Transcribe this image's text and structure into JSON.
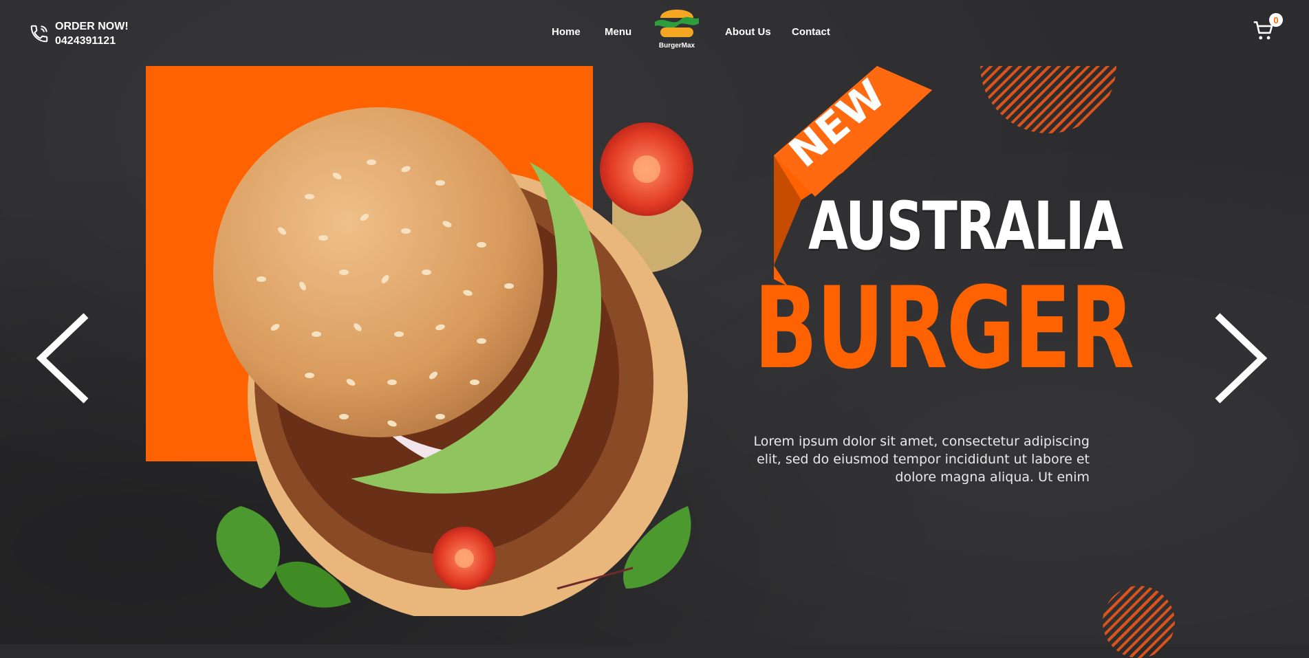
{
  "header": {
    "order_label": "ORDER NOW!",
    "phone": "0424391121",
    "nav": [
      "Home",
      "Menu",
      "About Us",
      "Contact"
    ],
    "logo_name": "BurgerMax",
    "cart_count": "0"
  },
  "hero": {
    "badge": "NEW",
    "title_line1": "AUSTRALIA",
    "title_line2": "BURGER",
    "description": "Lorem ipsum dolor sit amet, consectetur adipiscing elit, sed do eiusmod tempor incididunt ut labore et dolore magna aliqua. Ut enim"
  },
  "colors": {
    "accent": "#ff6200",
    "background": "#2c2c2e"
  },
  "icons": [
    "phone-icon",
    "cart-icon",
    "chevron-left-icon",
    "chevron-right-icon"
  ]
}
